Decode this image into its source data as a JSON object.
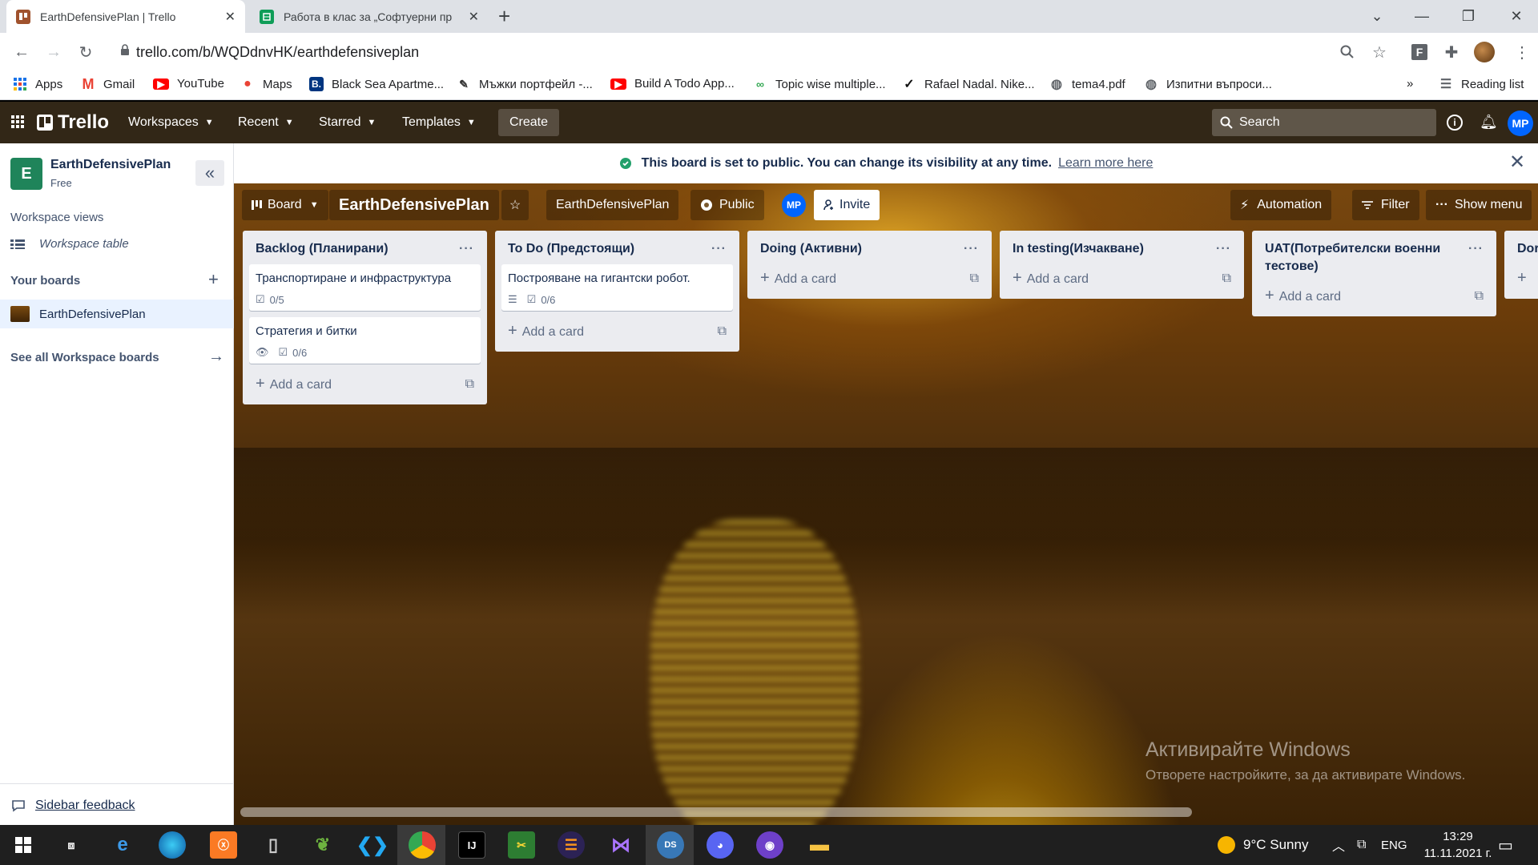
{
  "browser": {
    "tabs": [
      {
        "title": "EarthDefensivePlan | Trello",
        "active": true
      },
      {
        "title": "Работа в клас за „Софтуерни пр",
        "active": false
      }
    ],
    "url": "trello.com/b/WQDdnvHK/earthdefensiveplan",
    "bookmarks": [
      "Apps",
      "Gmail",
      "YouTube",
      "Maps",
      "Black Sea Apartme...",
      "Мъжки портфейл -...",
      "Build A Todo App...",
      "Topic wise multiple...",
      "Rafael Nadal. Nike...",
      "tema4.pdf",
      "Изпитни въпроси..."
    ],
    "reading_list": "Reading list"
  },
  "trello_header": {
    "logo": "Trello",
    "nav": [
      "Workspaces",
      "Recent",
      "Starred",
      "Templates"
    ],
    "create": "Create",
    "search_placeholder": "Search",
    "avatar": "MP",
    "header_color": "#322717"
  },
  "sidebar": {
    "workspace_initial": "E",
    "workspace_name": "EarthDefensivePlan",
    "plan": "Free",
    "views_heading": "Workspace views",
    "workspace_table": "Workspace table",
    "your_boards": "Your boards",
    "board": "EarthDefensivePlan",
    "see_all": "See all Workspace boards",
    "feedback": "Sidebar feedback"
  },
  "banner": {
    "text": "This board is set to public. You can change its visibility at any time.",
    "link": "Learn more here"
  },
  "board_header": {
    "view": "Board",
    "title": "EarthDefensivePlan",
    "workspace": "EarthDefensivePlan",
    "visibility": "Public",
    "member": "MP",
    "invite": "Invite",
    "automation": "Automation",
    "filter": "Filter",
    "show_menu": "Show menu"
  },
  "lists": [
    {
      "title": "Backlog (Планирани)",
      "cards": [
        {
          "title": "Транспортиране и инфраструктура",
          "checklist": "0/5",
          "watch": false,
          "desc": false
        },
        {
          "title": "Стратегия и битки",
          "checklist": "0/6",
          "watch": true,
          "desc": false
        }
      ]
    },
    {
      "title": "To Do (Предстоящи)",
      "cards": [
        {
          "title": "Построяване на гигантски робот.",
          "checklist": "0/6",
          "watch": false,
          "desc": true
        }
      ]
    },
    {
      "title": "Doing (Активни)",
      "cards": []
    },
    {
      "title": "In testing(Изчакване)",
      "cards": []
    },
    {
      "title": "UAT(Потребителски военни тестове)",
      "cards": []
    },
    {
      "title": "Dor",
      "cards": []
    }
  ],
  "add_card_label": "Add a card",
  "watermark": {
    "line1": "Активирайте Windows",
    "line2": "Отворете настройките, за да активирате Windows."
  },
  "taskbar": {
    "weather": "9°C  Sunny",
    "lang": "ENG",
    "time": "13:29",
    "date": "11.11.2021 г."
  }
}
